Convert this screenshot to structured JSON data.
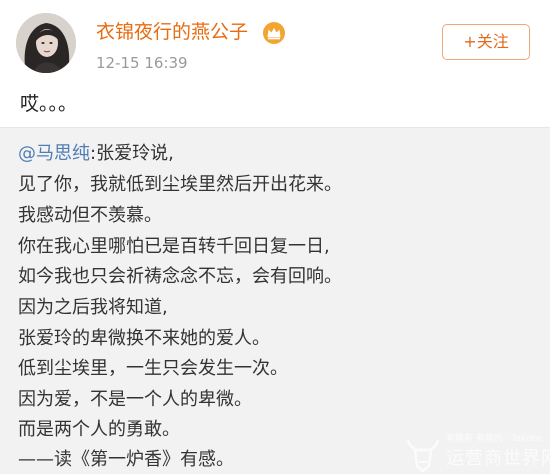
{
  "post": {
    "author": {
      "name": "衣锦夜行的燕公子",
      "avatar_icon": "avatar-photo",
      "badge_icon": "crown-icon",
      "name_color": "#e86b10"
    },
    "time": "12-15 16:39",
    "follow_label": "+关注",
    "text": "哎。。。"
  },
  "repost": {
    "mention": "@马思纯",
    "first_line_rest": ":张爱玲说,",
    "lines": [
      "见了你，我就低到尘埃里然后开出花来。",
      "我感动但不羡慕。",
      "你在我心里哪怕已是百转千回日复一日,",
      "如今我也只会祈祷念念不忘，会有回响。",
      "因为之后我将知道,",
      "张爱玲的卑微换不来她的爱人。",
      "低到尘埃里，一生只会发生一次。",
      "因为爱，不是一个人的卑微。",
      "而是两个人的勇敢。",
      "——读《第一炉香》有感。"
    ],
    "mention_color": "#4f7db5"
  },
  "watermark": {
    "top_text": "有趣有 有趣的 · Takoko",
    "main_text": "运营商世界网"
  }
}
